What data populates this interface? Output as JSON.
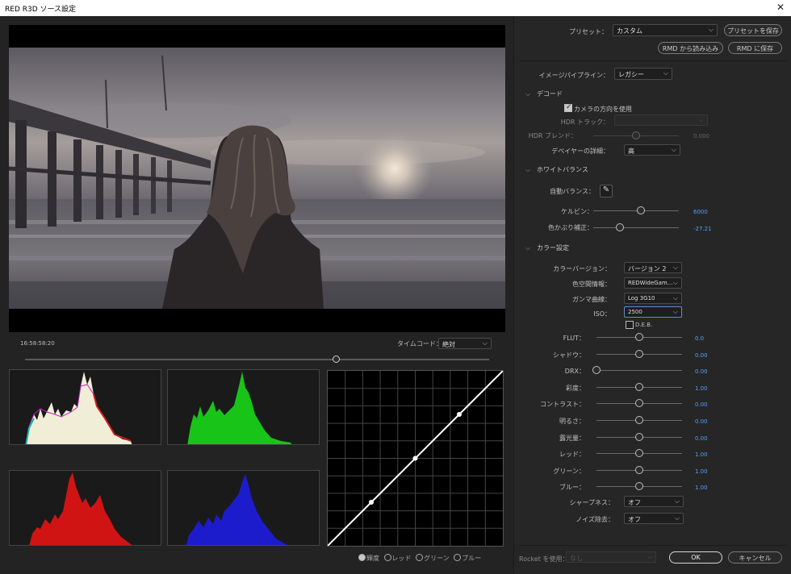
{
  "window": {
    "title": "RED R3D ソース設定",
    "close_glyph": "✕"
  },
  "preset": {
    "label": "プリセット：",
    "value": "カスタム",
    "save_button": "プリセットを保存",
    "rmd_load_button": "RMD から読み込み",
    "rmd_save_button": "RMD に保存"
  },
  "pipeline": {
    "label": "イメージパイプライン：",
    "value": "レガシー"
  },
  "decode": {
    "header": "デコード",
    "camera_orientation": {
      "label": "カメラの方向を使用",
      "checked": true
    },
    "hdr_track": {
      "label": "HDR トラック：",
      "value": ""
    },
    "hdr_blend": {
      "label": "HDR ブレンド：",
      "value": "0.000",
      "level": 0.5
    },
    "debayer": {
      "label": "デベイヤーの詳細：",
      "value": "高"
    }
  },
  "white_balance": {
    "header": "ホワイトバランス",
    "auto_label": "自動バランス：",
    "kelvin": {
      "label": "ケルビン：",
      "value": "6000",
      "level": 0.56
    },
    "tint": {
      "label": "色かぶり補正：",
      "value": "-27.21",
      "level": 0.31
    }
  },
  "color": {
    "header": "カラー設定",
    "version": {
      "label": "カラーバージョン：",
      "value": "バージョン 2"
    },
    "colorspace": {
      "label": "色空間情報：",
      "value": "REDWideGam..."
    },
    "gamma": {
      "label": "ガンマ曲線：",
      "value": "Log 3G10"
    },
    "iso": {
      "label": "ISO：",
      "value": "2500"
    },
    "deb": {
      "label": "D.E.B.",
      "checked": false
    },
    "sliders": [
      {
        "label": "FLUT：",
        "value": "0.0",
        "level": 0.5
      },
      {
        "label": "シャドウ：",
        "value": "0.00",
        "level": 0.5
      },
      {
        "label": "DRX：",
        "value": "0.00",
        "level": 0.0
      },
      {
        "label": "彩度：",
        "value": "1.00",
        "level": 0.5
      },
      {
        "label": "コントラスト：",
        "value": "0.00",
        "level": 0.5
      },
      {
        "label": "明るさ：",
        "value": "0.00",
        "level": 0.5
      },
      {
        "label": "露光量：",
        "value": "0.00",
        "level": 0.5
      },
      {
        "label": "レッド：",
        "value": "1.00",
        "level": 0.5
      },
      {
        "label": "グリーン：",
        "value": "1.00",
        "level": 0.5
      },
      {
        "label": "ブルー：",
        "value": "1.00",
        "level": 0.5
      }
    ],
    "sharpness": {
      "label": "シャープネス：",
      "value": "オフ"
    },
    "noise": {
      "label": "ノイズ除去：",
      "value": "オフ"
    }
  },
  "rocket": {
    "label": "Rocket を使用：",
    "value": "なし"
  },
  "footer": {
    "ok": "OK",
    "cancel": "キャンセル"
  },
  "timecode": {
    "readout": "16:58:58:20",
    "label": "タイムコード：",
    "value": "絶対",
    "playhead_level": 0.67
  },
  "curve_channels": [
    {
      "label": "輝度",
      "selected": true
    },
    {
      "label": "レッド",
      "selected": false
    },
    {
      "label": "グリーン",
      "selected": false
    },
    {
      "label": "ブルー",
      "selected": false
    }
  ],
  "colors": {
    "accent_value": "#4da3ff",
    "scope_luma": "#f0eed6",
    "scope_green": "#18c418",
    "scope_red": "#d01414",
    "scope_blue": "#1c1ccc"
  }
}
